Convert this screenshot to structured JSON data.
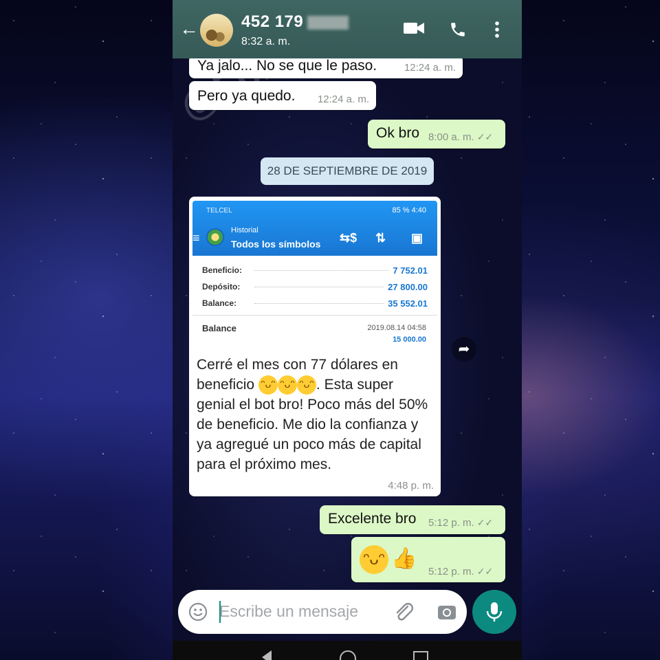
{
  "header": {
    "contact_name": "452 179",
    "last_seen": "8:32 a. m."
  },
  "watermark": "@ForexLiberty",
  "messages": [
    {
      "text": "Ya jalo... No se que le paso.",
      "time": "12:24 a. m."
    },
    {
      "text": "Pero ya quedo.",
      "time": "12:24 a. m."
    },
    {
      "text": "Ok bro",
      "time": "8:00 a. m.",
      "ticks": "✓✓"
    }
  ],
  "date_chip": "28 DE SEPTIEMBRE DE 2019",
  "screenshot": {
    "status_left": "TELCEL",
    "status_right": "85 %    4:40",
    "title_small": "Historial",
    "title_big": "Todos los símbolos",
    "rows": [
      {
        "label": "Beneficio:",
        "value": "7 752.01"
      },
      {
        "label": "Depósito:",
        "value": "27 800.00"
      },
      {
        "label": "Balance:",
        "value": "35 552.01"
      }
    ],
    "balance_label": "Balance",
    "balance_date": "2019.08.14 04:58",
    "balance_value": "15 000.00"
  },
  "image_message": {
    "text_1": "Cerré el mes con 77 dólares en beneficio",
    "text_2": ". Esta super genial el bot bro! Poco más del 50% de beneficio. Me dio la confianza y ya agregué un poco más de capital para el próximo mes.",
    "time": "4:48 p. m."
  },
  "replies": [
    {
      "text": "Excelente bro",
      "time": "5:12 p. m.",
      "ticks": "✓✓"
    },
    {
      "time": "5:12 p. m.",
      "ticks": "✓✓"
    }
  ],
  "input": {
    "placeholder": "Escribe un mensaje"
  },
  "icons": {
    "back": "arrow-left-icon",
    "video": "video-call-icon",
    "call": "phone-icon",
    "menu": "more-vert-icon",
    "emoji": "emoji-icon",
    "attach": "paperclip-icon",
    "camera": "camera-icon",
    "mic": "mic-icon",
    "forward": "forward-icon"
  },
  "colors": {
    "header": "#3f6662",
    "outgoing_bubble": "#dcf8c6",
    "incoming_bubble": "#ffffff",
    "accent": "#0c8a7f",
    "date_chip": "#d5e7f3",
    "mt_blue": "#1976d2"
  }
}
